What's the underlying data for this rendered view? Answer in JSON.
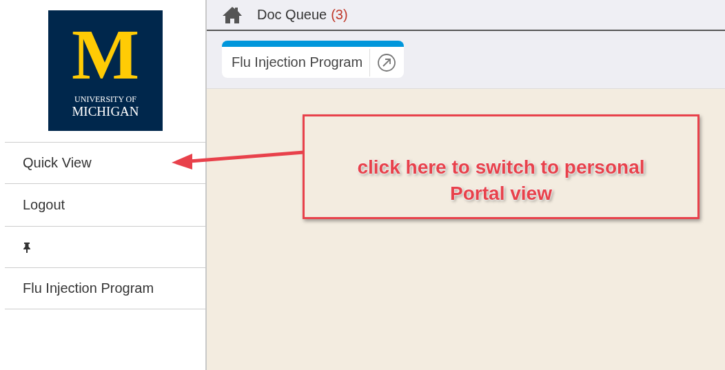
{
  "logo": {
    "letter": "M",
    "line_1": "UNIVERSITY OF",
    "line_2": "MICHIGAN"
  },
  "sidebar": {
    "items": [
      {
        "kind": "text",
        "label": "Quick View"
      },
      {
        "kind": "text",
        "label": "Logout"
      },
      {
        "kind": "pin"
      },
      {
        "kind": "text",
        "label": "Flu Injection Program"
      }
    ]
  },
  "top_bar": {
    "title": "Doc Queue",
    "count": "(3)"
  },
  "tabs": [
    {
      "label": "Flu Injection Program",
      "selected": true
    }
  ],
  "annotation": {
    "text": "click here to switch to personal Portal view"
  }
}
